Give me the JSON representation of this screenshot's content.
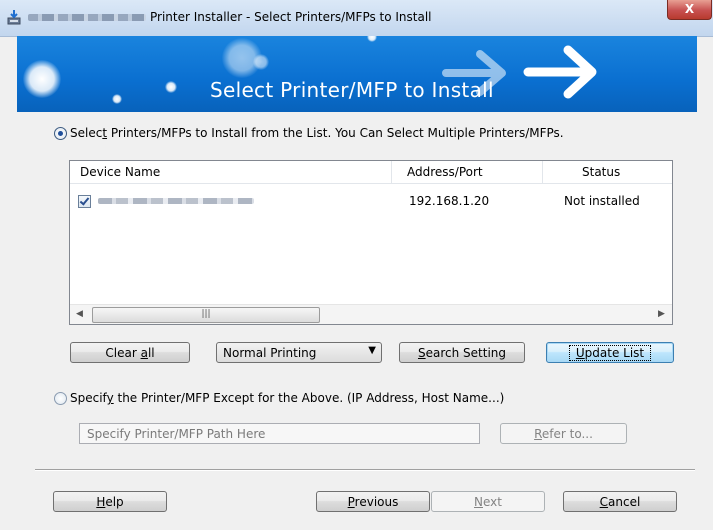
{
  "window": {
    "title": "Printer Installer - Select Printers/MFPs to Install",
    "close_glyph": "X"
  },
  "banner": {
    "title": "Select Printer/MFP to Install",
    "color": "#0a6fd0"
  },
  "option_list": {
    "label_pre": "Selec",
    "label_key": "t",
    "label_post": " Printers/MFPs to Install from the List. You Can Select Multiple Printers/MFPs.",
    "checked": true
  },
  "device_list": {
    "columns": [
      "Device Name",
      "Address/Port",
      "Status"
    ],
    "rows": [
      {
        "checked": true,
        "address": "192.168.1.20",
        "status": "Not installed"
      }
    ],
    "scroll_thumb_glyph": "|||"
  },
  "controls": {
    "clear_all_pre": "Clear ",
    "clear_all_key": "a",
    "clear_all_post": "ll",
    "printing_mode": "Normal Printing",
    "search_key": "S",
    "search_post": "earch Setting",
    "update_key": "U",
    "update_post": "pdate List"
  },
  "option_specify": {
    "label_pre": "Specif",
    "label_key": "y",
    "label_post": " the Printer/MFP Except for the Above. (IP Address, Host Name...)",
    "checked": false,
    "path_placeholder": "Specify Printer/MFP Path Here",
    "refer_key": "R",
    "refer_post": "efer to..."
  },
  "footer": {
    "help_key": "H",
    "help_post": "elp",
    "previous_key": "P",
    "previous_post": "revious",
    "next_key": "N",
    "next_post": "ext",
    "cancel_key": "C",
    "cancel_post": "ancel"
  }
}
